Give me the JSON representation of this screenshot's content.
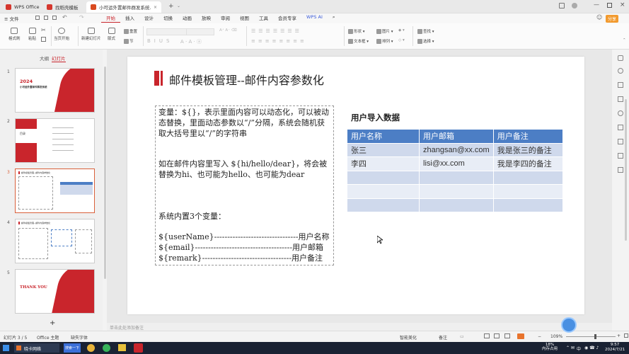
{
  "tabs": [
    {
      "label": "WPS Office",
      "color": "#d5372e"
    },
    {
      "label": "找稻壳模板",
      "color": "#d5372e"
    },
    {
      "label": "小可运外置邮件群发系统.pptx",
      "color": "#d94a1f"
    }
  ],
  "menu": {
    "file": "≡ 文件",
    "items": [
      "开始",
      "插入",
      "设计",
      "切换",
      "动画",
      "放映",
      "审阅",
      "视图",
      "工具",
      "会员专享"
    ],
    "ai": "WPS AI",
    "share": "分享"
  },
  "ribbon": {
    "format_painter": "格式刷",
    "paste": "粘贴",
    "from_current": "当页开始",
    "new_slide": "新建幻灯片",
    "layout": "版式",
    "section": "节",
    "reset": "重置",
    "shape": "形状",
    "picture": "图片",
    "textbox": "文本框",
    "arrange": "排列",
    "find": "查找",
    "select": "选择"
  },
  "sidebar": {
    "tab_outline": "大纲",
    "tab_slides": "幻灯片",
    "thumbs": [
      {
        "num": "1",
        "line1": "2024",
        "line2": "小可运外置邮件群发系统"
      },
      {
        "num": "2",
        "line1": "目录"
      },
      {
        "num": "3",
        "line1": "邮件模板管理--邮件内容参数化"
      },
      {
        "num": "4",
        "line1": "邮件模板管理--邮件内容参数化"
      },
      {
        "num": "5",
        "line1": "THANK YOU"
      }
    ],
    "add": "+"
  },
  "slide": {
    "title": "邮件模板管理--邮件内容参数化",
    "textbox": {
      "p1": "变量：${}，表示里面内容可以动态化，可以被动态替换，里面动态参数以“/”分隔，系统会随机获取大括号里以“/”的字符串",
      "p2": "如在邮件内容里写入 ${hi/hello/dear}，将会被替换为hi、也可能为hello、也可能为dear",
      "p3": "系统内置3个变量：",
      "v1": "${userName}--------------------------------用户名称",
      "v2": "${email}-------------------------------------用户邮箱",
      "v3": "${remark}----------------------------------用户备注"
    },
    "table_title": "用户导入数据",
    "table": {
      "headers": [
        "用户名称",
        "用户邮箱",
        "用户备注"
      ],
      "rows": [
        [
          "张三",
          "zhangsan@xx.com",
          "我是张三的备注"
        ],
        [
          "李四",
          "lisi@xx.com",
          "我是李四的备注"
        ],
        [
          "",
          "",
          ""
        ],
        [
          "",
          "",
          ""
        ],
        [
          "",
          "",
          ""
        ]
      ]
    }
  },
  "notes_placeholder": "单击此处添加备注",
  "status": {
    "slide_counter": "幻灯片 3 / 5",
    "theme": "Office 主题",
    "missing_font": "缺失字体",
    "beautify": "智能美化",
    "notes": "备注",
    "zoom": "109%"
  },
  "taskbar": {
    "app1": "晓卡网络",
    "app2": "搜索一下",
    "mem": "18%",
    "mem_label": "内存占用",
    "time": "9:57",
    "date": "2024/7/21",
    "lang": "中"
  },
  "colors": {
    "accent": "#c9252c",
    "table_header": "#4c7ec5",
    "table_odd": "#cfd9ec",
    "table_even": "#e8edf6"
  }
}
